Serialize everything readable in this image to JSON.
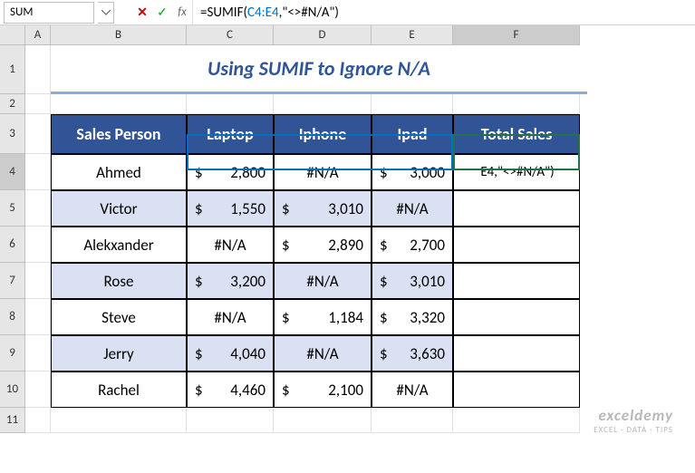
{
  "name_box": "SUM",
  "formula_bar": {
    "prefix": "=SUMIF(",
    "range": "C4:E4",
    "suffix": ",\"<>#N/A\")"
  },
  "columns": [
    "A",
    "B",
    "C",
    "D",
    "E",
    "F"
  ],
  "row_numbers": [
    "1",
    "2",
    "3",
    "4",
    "5",
    "6",
    "7",
    "8",
    "9",
    "10",
    "11"
  ],
  "title": "Using SUMIF to Ignore N/A",
  "headers": {
    "sales_person": "Sales Person",
    "laptop": "Laptop",
    "iphone": "Iphone",
    "ipad": "Ipad",
    "total_sales": "Total Sales"
  },
  "active_cell_text": "E4,\"<>#N/A\")",
  "watermark": {
    "line1": "exceldemy",
    "line2": "EXCEL · DATA · TIPS"
  },
  "chart_data": {
    "type": "table",
    "columns": [
      "Sales Person",
      "Laptop",
      "Iphone",
      "Ipad",
      "Total Sales"
    ],
    "rows": [
      {
        "Sales Person": "Ahmed",
        "Laptop": 2800,
        "Iphone": "#N/A",
        "Ipad": 3000,
        "Total Sales": null
      },
      {
        "Sales Person": "Victor",
        "Laptop": 1550,
        "Iphone": 3010,
        "Ipad": "#N/A",
        "Total Sales": null
      },
      {
        "Sales Person": "Alekxander",
        "Laptop": "#N/A",
        "Iphone": 2890,
        "Ipad": 2700,
        "Total Sales": null
      },
      {
        "Sales Person": "Rose",
        "Laptop": 3200,
        "Iphone": "#N/A",
        "Ipad": 3010,
        "Total Sales": null
      },
      {
        "Sales Person": "Steve",
        "Laptop": "#N/A",
        "Iphone": 1184,
        "Ipad": 3320,
        "Total Sales": null
      },
      {
        "Sales Person": "Jerry",
        "Laptop": 4040,
        "Iphone": "#N/A",
        "Ipad": 3630,
        "Total Sales": null
      },
      {
        "Sales Person": "Rachel",
        "Laptop": 4460,
        "Iphone": 2100,
        "Ipad": "#N/A",
        "Total Sales": null
      }
    ]
  },
  "table": {
    "rows": [
      {
        "name": "Ahmed",
        "laptop": "2,800",
        "iphone": "#N/A",
        "ipad": "3,000"
      },
      {
        "name": "Victor",
        "laptop": "1,550",
        "iphone": "3,010",
        "ipad": "#N/A"
      },
      {
        "name": "Alekxander",
        "laptop": "#N/A",
        "iphone": "2,890",
        "ipad": "2,700"
      },
      {
        "name": "Rose",
        "laptop": "3,200",
        "iphone": "#N/A",
        "ipad": "3,010"
      },
      {
        "name": "Steve",
        "laptop": "#N/A",
        "iphone": "1,184",
        "ipad": "3,320"
      },
      {
        "name": "Jerry",
        "laptop": "4,040",
        "iphone": "#N/A",
        "ipad": "3,630"
      },
      {
        "name": "Rachel",
        "laptop": "4,460",
        "iphone": "2,100",
        "ipad": "#N/A"
      }
    ]
  }
}
